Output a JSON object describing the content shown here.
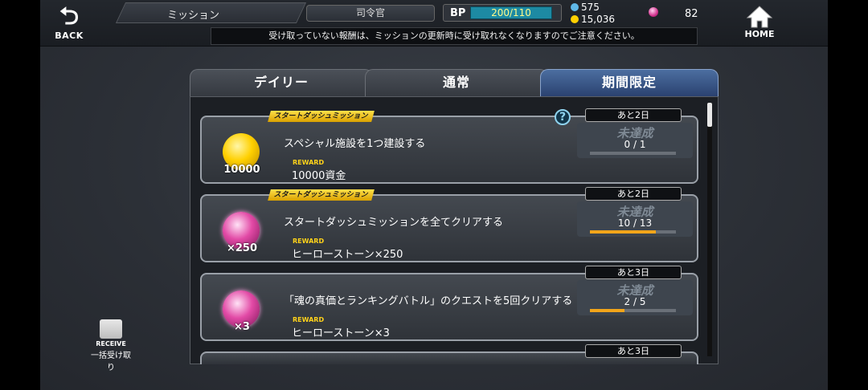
{
  "header": {
    "back_label": "BACK",
    "home_label": "HOME",
    "title": "ミッション",
    "rank": "司令官",
    "bp_label": "BP",
    "bp_value": "200/110",
    "currency_1": "575",
    "currency_2": "15,036",
    "hero_stones": "82",
    "notice": "受け取っていない報酬は、ミッションの更新時に受け取れなくなりますのでご注意ください。"
  },
  "tabs": [
    {
      "label": "デイリー",
      "active": false
    },
    {
      "label": "通常",
      "active": false
    },
    {
      "label": "期間限定",
      "active": true
    }
  ],
  "missions": [
    {
      "ribbon": "スタートダッシュミッション",
      "description": "スペシャル施設を1つ建設する",
      "reward_label": "REWARD",
      "reward": "10000資金",
      "icon": "coin-icon",
      "quantity": "10000",
      "days_left": "あと2日",
      "status": "未達成",
      "progress": "0 / 1",
      "progress_fraction": 0.0
    },
    {
      "ribbon": "スタートダッシュミッション",
      "description": "スタートダッシュミッションを全てクリアする",
      "reward_label": "REWARD",
      "reward": "ヒーローストーン×250",
      "icon": "gem-icon",
      "quantity": "×250",
      "days_left": "あと2日",
      "status": "未達成",
      "progress": "10 / 13",
      "progress_fraction": 0.77
    },
    {
      "description": "「魂の真価とランキングバトル」のクエストを5回クリアする",
      "reward_label": "REWARD",
      "reward": "ヒーローストーン×3",
      "icon": "gem-icon",
      "quantity": "×3",
      "days_left": "あと3日",
      "status": "未達成",
      "progress": "2 / 5",
      "progress_fraction": 0.4
    },
    {
      "days_left": "あと3日"
    }
  ],
  "receive_all": {
    "label_en": "RECEIVE",
    "label_jp": "一括受け取り"
  },
  "colors": {
    "accent_yellow": "#ffd21a",
    "progress_orange": "#f2a51a",
    "active_tab": "#3a5a8c"
  }
}
